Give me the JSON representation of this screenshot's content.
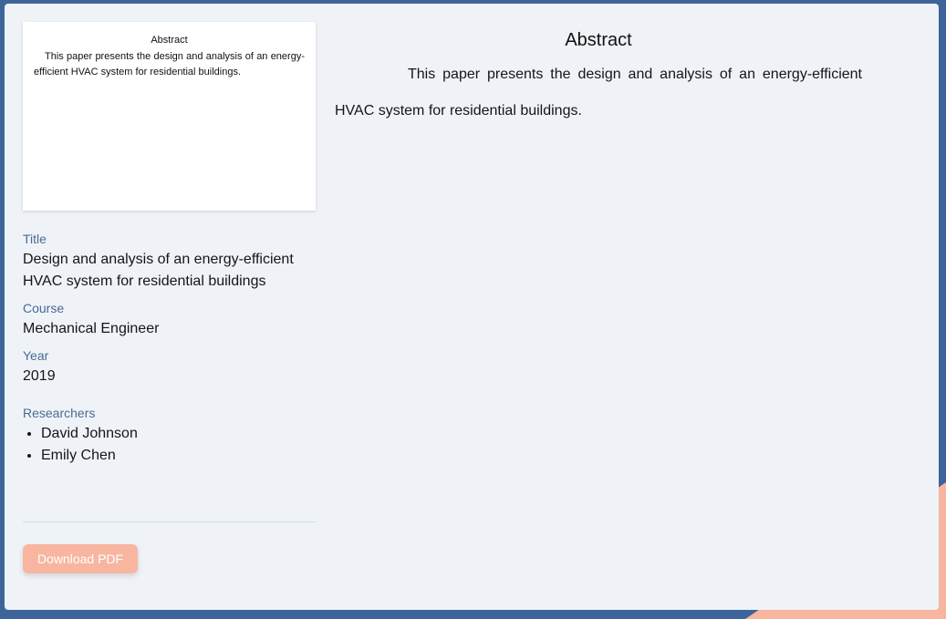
{
  "preview": {
    "heading": "Abstract",
    "text": "This paper presents the design and analysis of an energy-efficient HVAC system for residential buildings."
  },
  "details": {
    "title_label": "Title",
    "title_value": "Design and analysis of an energy-efficient HVAC system for residential buildings",
    "course_label": "Course",
    "course_value": "Mechanical Engineer",
    "year_label": "Year",
    "year_value": "2019",
    "researchers_label": "Researchers",
    "researchers": [
      "David Johnson",
      "Emily Chen"
    ]
  },
  "actions": {
    "download_label": "Download PDF"
  },
  "abstract": {
    "heading": "Abstract",
    "text": "This paper presents the design and analysis of an energy-efficient HVAC system for residential buildings."
  },
  "colors": {
    "background": "#3d6599",
    "accent": "#f8b6a0",
    "card": "#eff3f8",
    "label": "#4c6a92"
  }
}
